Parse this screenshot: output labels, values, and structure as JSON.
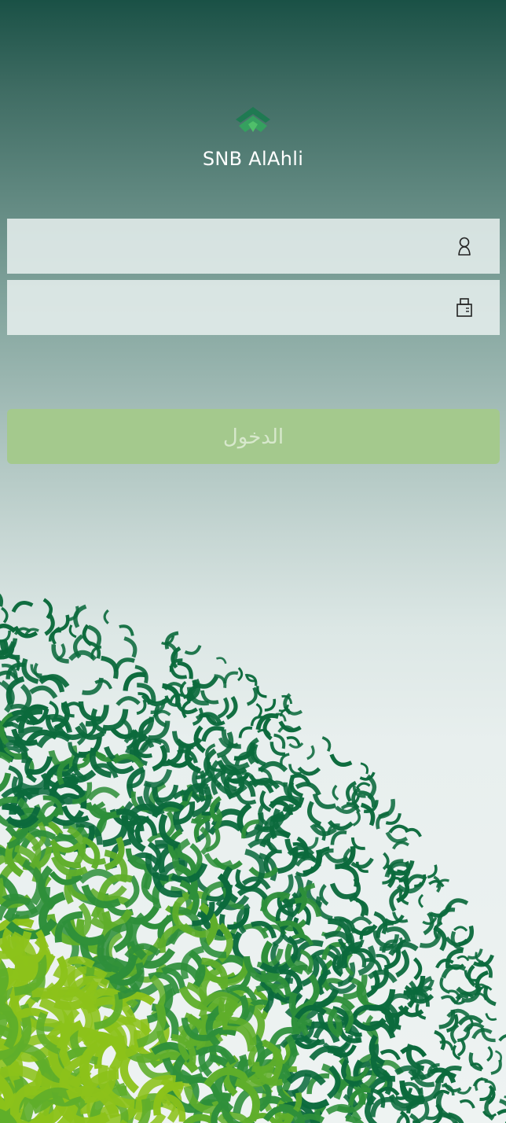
{
  "brand": {
    "name": "SNB AlAhli",
    "logo_icon": "snb-chevron-logo-icon",
    "logo_color": "#2f8a5c"
  },
  "login_form": {
    "username": {
      "value": "",
      "placeholder": "",
      "icon": "user-icon"
    },
    "password": {
      "value": "",
      "placeholder": "",
      "icon": "lock-icon"
    },
    "submit_label": "الدخول",
    "submit_color": "#a4c98d"
  },
  "background": {
    "top_color": "#1a5146",
    "bottom_color": "#eef3f2",
    "art_colors": [
      "#0b6a3c",
      "#2e8f3a",
      "#5fae2a",
      "#8cc21a"
    ]
  }
}
